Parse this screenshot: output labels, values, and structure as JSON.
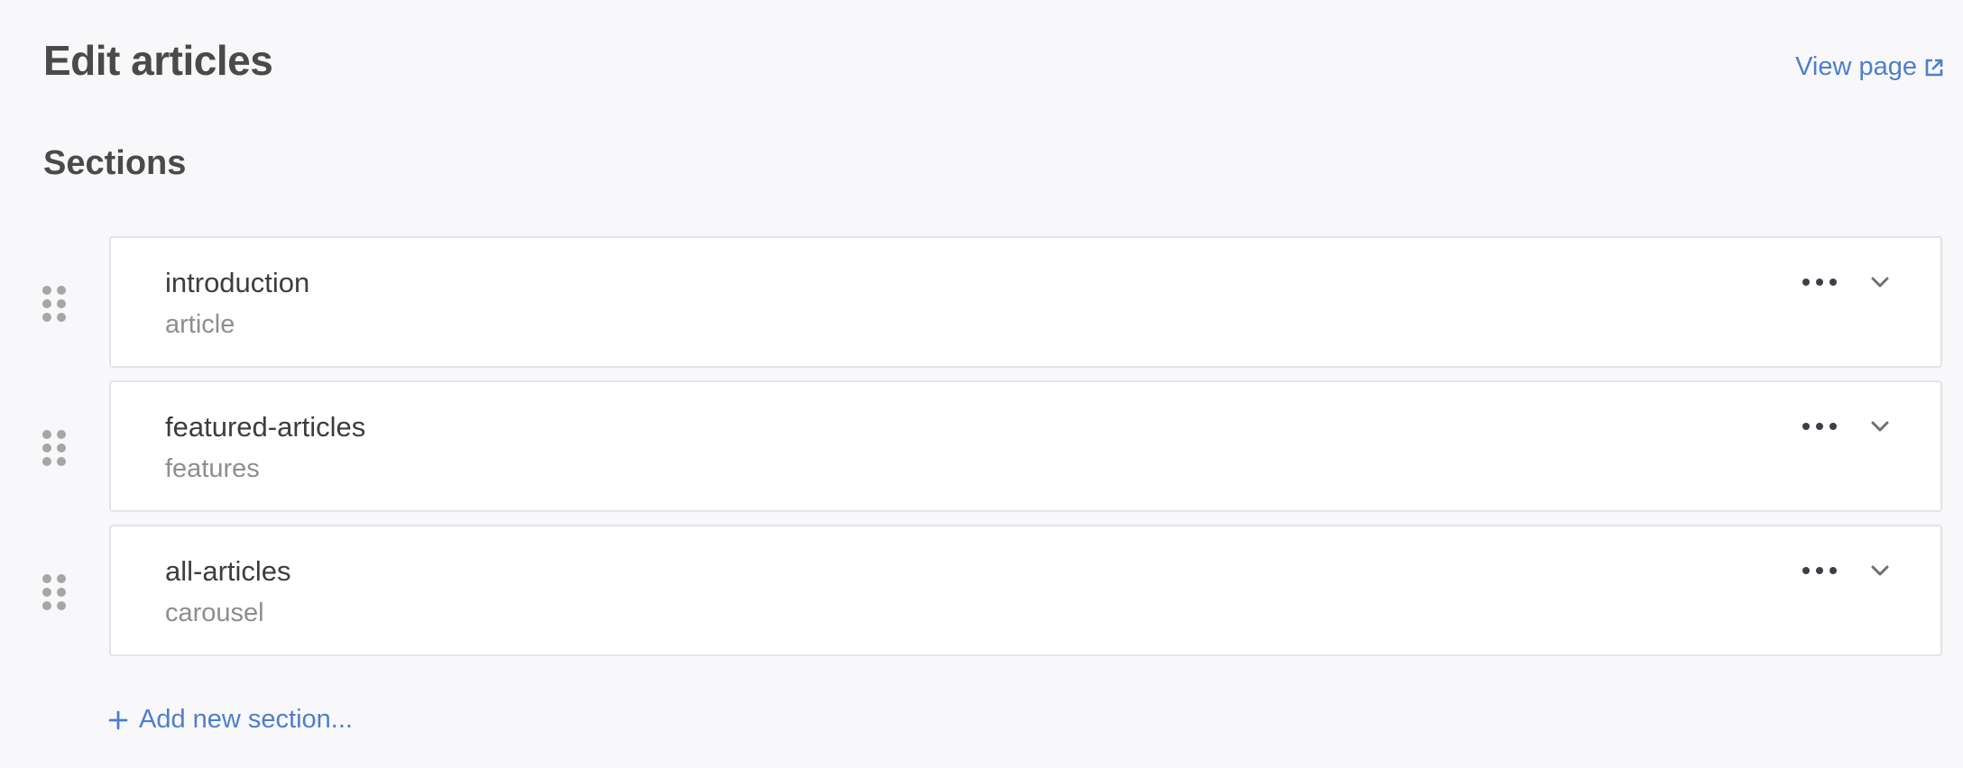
{
  "header": {
    "title": "Edit articles",
    "view_page_label": "View page",
    "view_page_icon": "external-link-icon"
  },
  "sections": {
    "heading": "Sections",
    "items": [
      {
        "name": "introduction",
        "type": "article"
      },
      {
        "name": "featured-articles",
        "type": "features"
      },
      {
        "name": "all-articles",
        "type": "carousel"
      }
    ],
    "add_label": "Add new section..."
  },
  "colors": {
    "background": "#f8f8fa",
    "link_blue": "#4f7ec9",
    "card_border": "#e3e3e8",
    "handle_grey": "#a6a6a6"
  }
}
